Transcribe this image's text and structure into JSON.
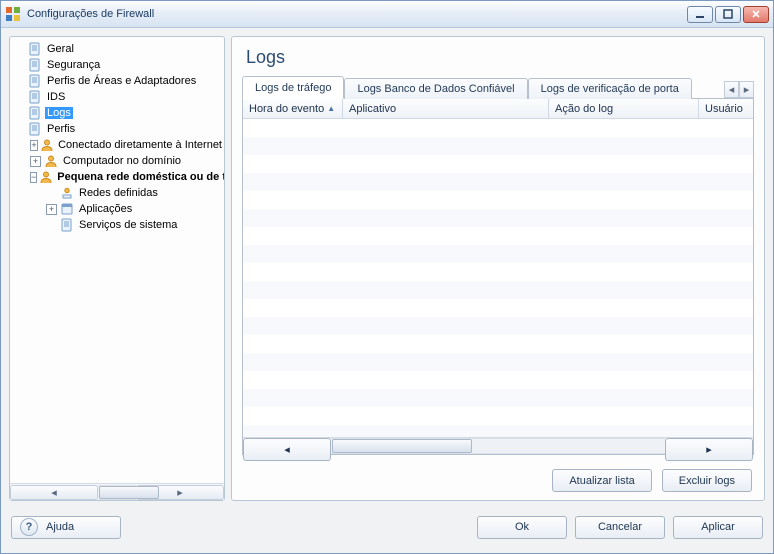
{
  "window": {
    "title": "Configurações de Firewall"
  },
  "tree": {
    "items": [
      {
        "label": "Geral"
      },
      {
        "label": "Segurança"
      },
      {
        "label": "Perfis de Áreas e Adaptadores"
      },
      {
        "label": "IDS"
      },
      {
        "label": "Logs"
      },
      {
        "label": "Perfis"
      },
      {
        "label": "Conectado diretamente à Internet"
      },
      {
        "label": "Computador no domínio"
      },
      {
        "label": "Pequena rede doméstica ou de trabalho"
      },
      {
        "label": "Redes definidas"
      },
      {
        "label": "Aplicações"
      },
      {
        "label": "Serviços de sistema"
      }
    ]
  },
  "main": {
    "heading": "Logs",
    "tabs": [
      {
        "label": "Logs de tráfego"
      },
      {
        "label": "Logs Banco de Dados Confiável"
      },
      {
        "label": "Logs de verificação de porta"
      }
    ],
    "columns": [
      {
        "label": "Hora do evento"
      },
      {
        "label": "Aplicativo"
      },
      {
        "label": "Ação do log"
      },
      {
        "label": "Usuário"
      }
    ],
    "buttons": {
      "refresh": "Atualizar lista",
      "clear": "Excluir logs"
    }
  },
  "footer": {
    "help": "Ajuda",
    "ok": "Ok",
    "cancel": "Cancelar",
    "apply": "Aplicar"
  }
}
